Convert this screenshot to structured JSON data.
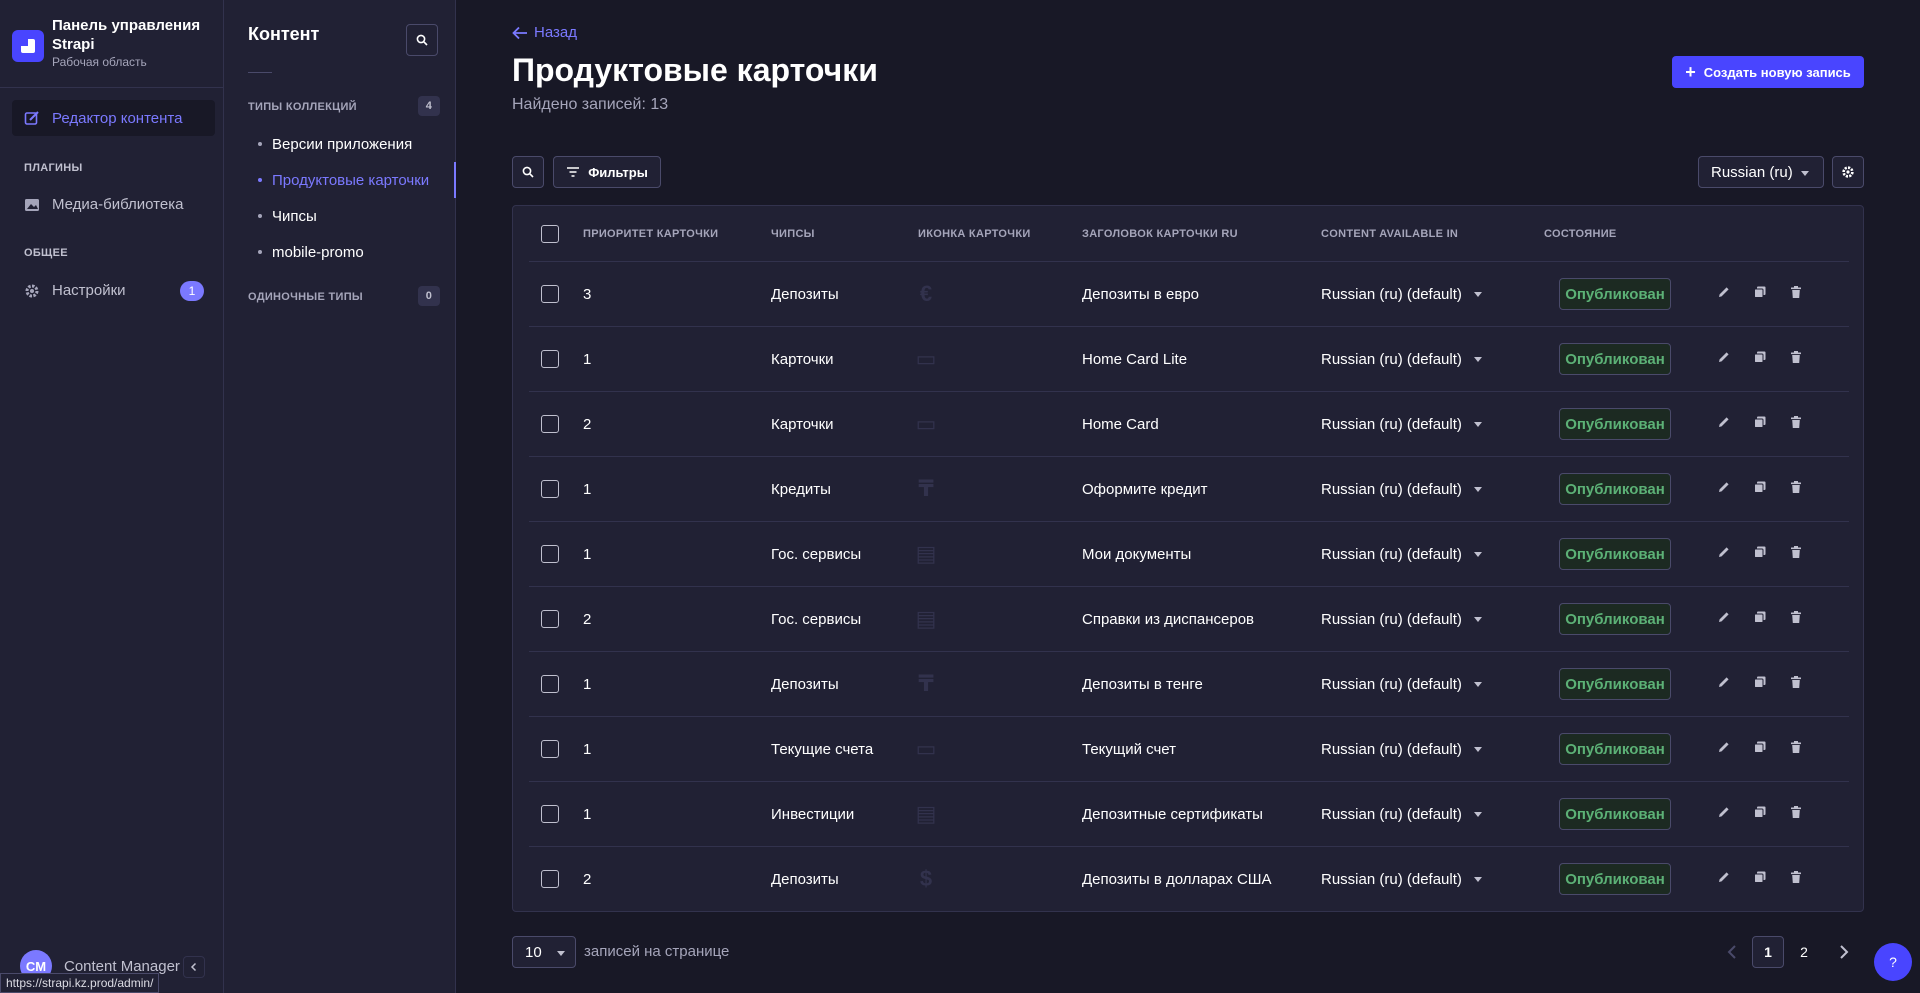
{
  "brand": {
    "title": "Панель управления Strapi",
    "subtitle": "Рабочая область"
  },
  "mainnav": {
    "active_label": "Редактор контента",
    "plugins_section": "ПЛАГИНЫ",
    "media_label": "Медиа-библиотека",
    "general_section": "ОБЩЕЕ",
    "settings_label": "Настройки",
    "settings_badge": "1",
    "user_initials": "CM",
    "user_name": "Content Manager"
  },
  "status_url": "https://strapi.kz.prod/admin/",
  "subnav": {
    "title": "Контент",
    "collection_section": "ТИПЫ КОЛЛЕКЦИЙ",
    "collection_count": "4",
    "items": [
      {
        "label": "Версии приложения"
      },
      {
        "label": "Продуктовые карточки"
      },
      {
        "label": "Чипсы"
      },
      {
        "label": "mobile-promo"
      }
    ],
    "single_section": "ОДИНОЧНЫЕ ТИПЫ",
    "single_count": "0"
  },
  "header": {
    "back_label": "Назад",
    "title": "Продуктовые карточки",
    "subtitle": "Найдено записей: 13",
    "create_label": "Создать новую запись"
  },
  "toolbar": {
    "filters_label": "Фильтры",
    "locale_value": "Russian (ru)"
  },
  "table": {
    "headers": {
      "priority": "ПРИОРИТЕТ КАРТОЧКИ",
      "chips": "ЧИПСЫ",
      "icon": "ИКОНКА КАРТОЧКИ",
      "title": "ЗАГОЛОВОК КАРТОЧКИ RU",
      "locales": "CONTENT AVAILABLE IN",
      "status": "СОСТОЯНИЕ"
    },
    "rows": [
      {
        "priority": "3",
        "chip": "Депозиты",
        "icon": "€",
        "title": "Депозиты в евро",
        "locale": "Russian (ru) (default)",
        "status": "Опубликован"
      },
      {
        "priority": "1",
        "chip": "Карточки",
        "icon": "▭",
        "title": "Home Card Lite",
        "locale": "Russian (ru) (default)",
        "status": "Опубликован"
      },
      {
        "priority": "2",
        "chip": "Карточки",
        "icon": "▭",
        "title": "Home Card",
        "locale": "Russian (ru) (default)",
        "status": "Опубликован"
      },
      {
        "priority": "1",
        "chip": "Кредиты",
        "icon": "₸",
        "title": "Оформите кредит",
        "locale": "Russian (ru) (default)",
        "status": "Опубликован"
      },
      {
        "priority": "1",
        "chip": "Гос. сервисы",
        "icon": "▤",
        "title": "Мои документы",
        "locale": "Russian (ru) (default)",
        "status": "Опубликован"
      },
      {
        "priority": "2",
        "chip": "Гос. сервисы",
        "icon": "▤",
        "title": "Справки из диспансеров",
        "locale": "Russian (ru) (default)",
        "status": "Опубликован"
      },
      {
        "priority": "1",
        "chip": "Депозиты",
        "icon": "₸",
        "title": "Депозиты в тенге",
        "locale": "Russian (ru) (default)",
        "status": "Опубликован"
      },
      {
        "priority": "1",
        "chip": "Текущие счета",
        "icon": "▭",
        "title": "Текущий счет",
        "locale": "Russian (ru) (default)",
        "status": "Опубликован"
      },
      {
        "priority": "1",
        "chip": "Инвестиции",
        "icon": "▤",
        "title": "Депозитные сертификаты",
        "locale": "Russian (ru) (default)",
        "status": "Опубликован"
      },
      {
        "priority": "2",
        "chip": "Депозиты",
        "icon": "$",
        "title": "Депозиты в долларах США",
        "locale": "Russian (ru) (default)",
        "status": "Опубликован"
      }
    ]
  },
  "footer": {
    "per_page_value": "10",
    "per_page_label": "записей на странице",
    "pages": [
      "1",
      "2"
    ],
    "current_page": "1",
    "help_label": "?"
  }
}
